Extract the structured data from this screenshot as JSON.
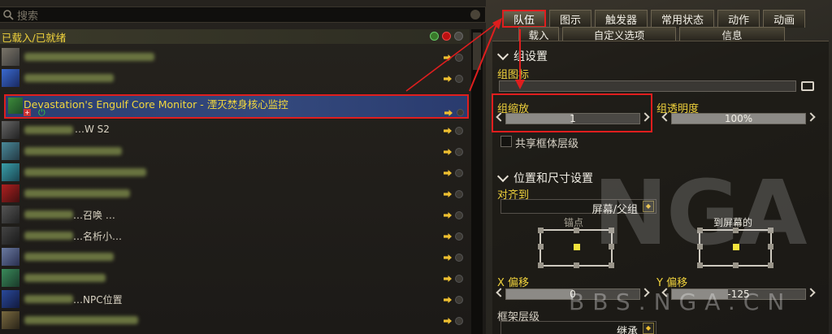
{
  "search": {
    "placeholder": "搜索"
  },
  "list": {
    "group_title": "已载入/已就绪",
    "selected_item": "Devastation's Engulf Core Monitor - 湮灭焚身核心监控",
    "row_fragments": [
      "…W S2",
      "…召唤 …",
      "…名析小…",
      "…NPC位置"
    ]
  },
  "tabs": {
    "row1": [
      "队伍",
      "图示",
      "触发器",
      "常用状态",
      "动作",
      "动画"
    ],
    "row2": [
      "载入",
      "自定义选项",
      "信息"
    ],
    "active": "队伍"
  },
  "group_settings": {
    "section_title": "组设置",
    "icon_label": "组图标",
    "scale_label": "组缩放",
    "scale_value": "1",
    "alpha_label": "组透明度",
    "alpha_value": "100%",
    "alpha_fraction": 1.0,
    "scale_fraction": 0.5,
    "shared_frame_label": "共享框体层级"
  },
  "position_settings": {
    "section_title": "位置和尺寸设置",
    "align_label": "对齐到",
    "align_value": "屏幕/父组",
    "anchor_title": "锚点",
    "to_screen_title": "到屏幕的",
    "x_label": "X 偏移",
    "x_value": "0",
    "y_label": "Y 偏移",
    "y_value": "-125",
    "frame_level_label": "框架层级",
    "frame_level_value": "继承"
  },
  "watermark": {
    "text": "BBS.NGA.CN",
    "logo": "NGA"
  },
  "colors": {
    "accent_yellow": "#f0d23c",
    "selection_blue": "#2b3e72",
    "annotation_red": "#e01e1e"
  }
}
